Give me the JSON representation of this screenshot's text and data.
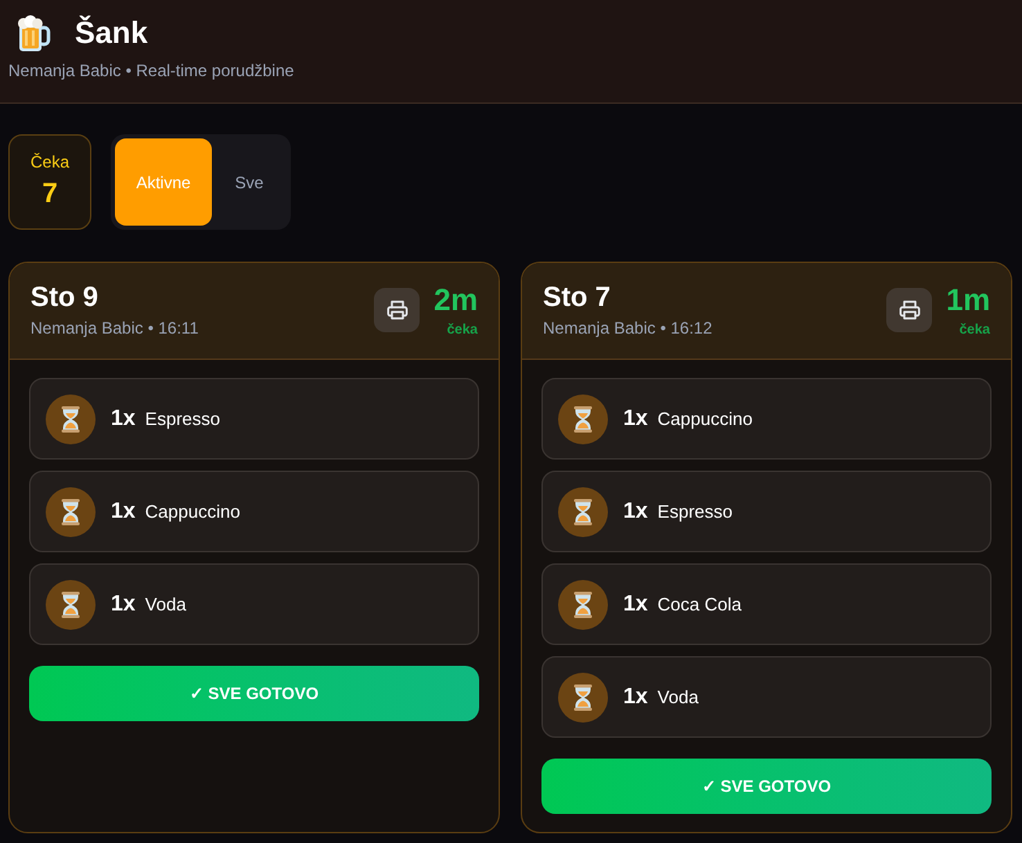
{
  "header": {
    "title": "Šank",
    "subtitle": "Nemanja Babic • Real-time porudžbine"
  },
  "stats": [
    {
      "label": "Čeka",
      "value": "7"
    }
  ],
  "filter_tabs": [
    {
      "label": "Aktivne",
      "selected": true
    },
    {
      "label": "Sve",
      "selected": false
    }
  ],
  "orders": [
    {
      "table": "Sto 9",
      "meta": "Nemanja Babic • 16:11",
      "elapsed": "2m",
      "elapsed_label": "čeka",
      "items": [
        {
          "quantity": "1x",
          "name": "Espresso"
        },
        {
          "quantity": "1x",
          "name": "Cappuccino"
        },
        {
          "quantity": "1x",
          "name": "Voda"
        }
      ],
      "action": "✓ SVE GOTOVO"
    },
    {
      "table": "Sto 7",
      "meta": "Nemanja Babic • 16:12",
      "elapsed": "1m",
      "elapsed_label": "čeka",
      "items": [
        {
          "quantity": "1x",
          "name": "Cappuccino"
        },
        {
          "quantity": "1x",
          "name": "Espresso"
        },
        {
          "quantity": "1x",
          "name": "Coca Cola"
        },
        {
          "quantity": "1x",
          "name": "Voda"
        }
      ],
      "action": "✓ SVE GOTOVO"
    }
  ]
}
